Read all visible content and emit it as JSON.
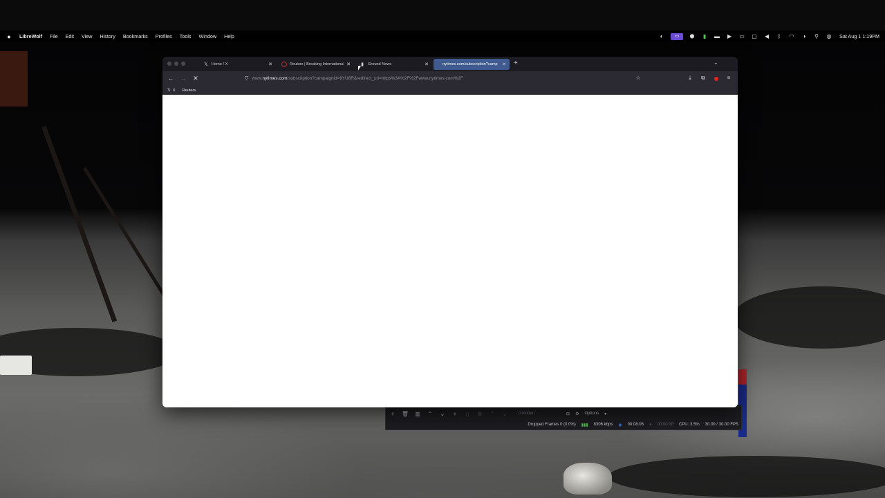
{
  "menubar": {
    "app_name": "LibreWolf",
    "items": [
      "File",
      "Edit",
      "View",
      "History",
      "Bookmarks",
      "Profiles",
      "Tools",
      "Window",
      "Help"
    ],
    "clock": "Sat Aug 1  1:19PM"
  },
  "browser": {
    "tabs": [
      {
        "title": "Home / X",
        "favicon": "x-logo-icon",
        "active": false
      },
      {
        "title": "Reuters | Breaking International",
        "favicon": "reuters-icon",
        "active": false
      },
      {
        "title": "Ground News",
        "favicon": "ground-news-icon",
        "active": false
      },
      {
        "title": "nytimes.com/subscription?camp",
        "favicon": "none",
        "active": true
      }
    ],
    "url": {
      "prefix": "www.",
      "domain": "nytimes.com",
      "path": "/subscription?campaignid=9YU8R&redirect_uri=https%3A%2F%2Fwww.nytimes.com%2F"
    },
    "bookmarks": [
      {
        "label": "X",
        "favicon": "x-logo-icon"
      },
      {
        "label": "Reuters",
        "favicon": "reuters-icon"
      }
    ],
    "page_state": "loading",
    "accent_color": "#3f5a8f"
  },
  "obs": {
    "hidden_label": "0 hidden",
    "options_label": "Options",
    "dropped_frames": "Dropped Frames 0 (0.0%)",
    "bitrate": "8306 kbps",
    "stream_time": "00:08:06",
    "record_time": "00:00:00",
    "cpu": "CPU: 3.5%",
    "fps": "30.00 / 30.00 FPS"
  }
}
